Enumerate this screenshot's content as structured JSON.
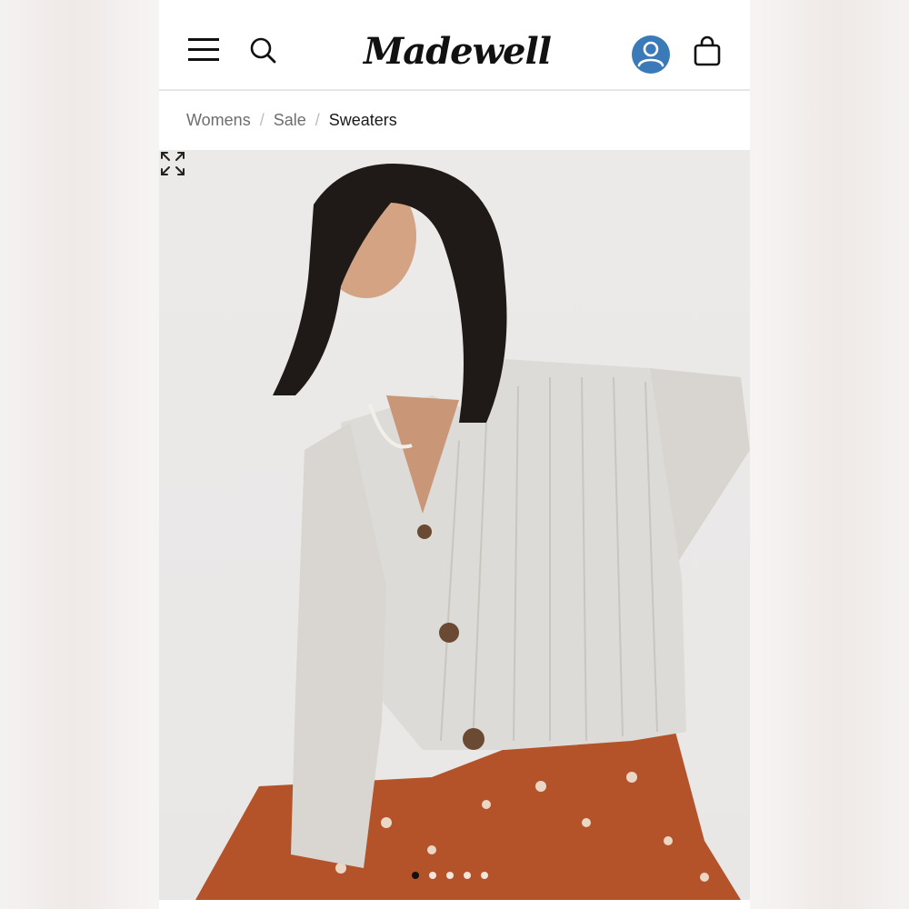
{
  "brand": {
    "logo_text": "Madewell"
  },
  "header": {
    "icons": [
      "menu-icon",
      "search-icon",
      "account-icon",
      "bag-icon"
    ],
    "account_icon_color": "#3a7ab8"
  },
  "breadcrumb": {
    "items": [
      "Womens",
      "Sale",
      "Sweaters"
    ],
    "separator": "/"
  },
  "gallery": {
    "image_count": 5,
    "active_index": 1,
    "expand_icon": "expand-icon"
  },
  "colors": {
    "text_primary": "#1a1a1a",
    "text_secondary": "#6d6d6d",
    "skirt": "#b4532a",
    "cardigan": "#dddbd7"
  }
}
